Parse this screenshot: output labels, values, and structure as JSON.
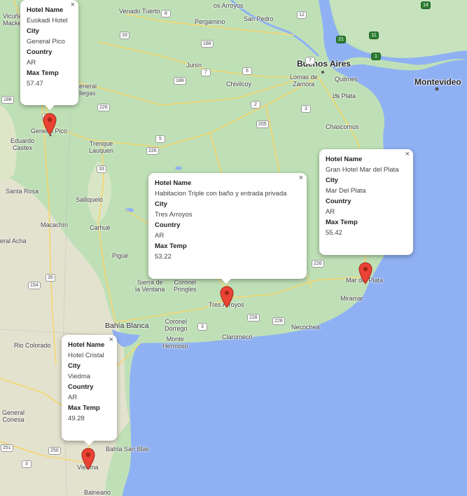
{
  "places": [
    {
      "id": "vicuna-mackenna",
      "text": "Vicuña\nMacke..."
    },
    {
      "id": "venado-tuerto",
      "text": "Venado Tuerto"
    },
    {
      "id": "los-arroyos",
      "text": "os Arroyos"
    },
    {
      "id": "pergamino",
      "text": "Pergamino"
    },
    {
      "id": "san-pedro",
      "text": "San Pedro"
    },
    {
      "id": "buenos-aires",
      "text": "Buenos Aires"
    },
    {
      "id": "montevideo",
      "text": "Montevideo"
    },
    {
      "id": "lomas-de-zamora",
      "text": "Lomas de\nZamora"
    },
    {
      "id": "quilmes",
      "text": "Quilmes"
    },
    {
      "id": "la-plata",
      "text": "La Plata"
    },
    {
      "id": "junin",
      "text": "Junín"
    },
    {
      "id": "chivilcoy",
      "text": "Chivilcoy"
    },
    {
      "id": "general-villegas",
      "text": "eneral\nllegas"
    },
    {
      "id": "general-pico",
      "text": "General Pico"
    },
    {
      "id": "eduardo-castex",
      "text": "Eduardo\nCastex"
    },
    {
      "id": "trenque-lauquen",
      "text": "Trenque\nLauquen"
    },
    {
      "id": "chascomus",
      "text": "Chascomús"
    },
    {
      "id": "santa-rosa",
      "text": "Santa Rosa"
    },
    {
      "id": "salliquelo",
      "text": "Salliqueló"
    },
    {
      "id": "macachin",
      "text": "Macachín"
    },
    {
      "id": "carhue",
      "text": "Carhué"
    },
    {
      "id": "general-acha",
      "text": "eral Acha"
    },
    {
      "id": "pigue",
      "text": "Pigüé"
    },
    {
      "id": "sierra-de-la-ventana",
      "text": "Sierra de\nla Ventana"
    },
    {
      "id": "coronel-pringles",
      "text": "Coronel\nPringles"
    },
    {
      "id": "tres-arroyos",
      "text": "Tres Arroyos"
    },
    {
      "id": "mar-del-plata",
      "text": "Mar del Plata"
    },
    {
      "id": "miramar",
      "text": "Miramar"
    },
    {
      "id": "necochea",
      "text": "Necochea"
    },
    {
      "id": "bahia-blanca",
      "text": "Bahía Blanca"
    },
    {
      "id": "coronel-dorrego",
      "text": "Coronel\nDorrego"
    },
    {
      "id": "monte-hermoso",
      "text": "Monte\nHermoso"
    },
    {
      "id": "claromeco",
      "text": "Claromecó"
    },
    {
      "id": "rio-colorado",
      "text": "Rio Colorado"
    },
    {
      "id": "general-conesa",
      "text": "General\nConesa"
    },
    {
      "id": "bahia-san-blas",
      "text": "Bahía San Blas"
    },
    {
      "id": "viedma",
      "text": "Viedma"
    },
    {
      "id": "balneario",
      "text": "Balneario"
    }
  ],
  "route_shields": [
    {
      "id": "r8",
      "text": "8"
    },
    {
      "id": "r12",
      "text": "12"
    },
    {
      "id": "r33a",
      "text": "33"
    },
    {
      "id": "r188a",
      "text": "188"
    },
    {
      "id": "r188b",
      "text": "188"
    },
    {
      "id": "r188c",
      "text": "188"
    },
    {
      "id": "r7a",
      "text": "7"
    },
    {
      "id": "r7b",
      "text": "7"
    },
    {
      "id": "r5a",
      "text": "5"
    },
    {
      "id": "r5b",
      "text": "5"
    },
    {
      "id": "r205",
      "text": "205"
    },
    {
      "id": "r3a",
      "text": "3"
    },
    {
      "id": "r2",
      "text": "2"
    },
    {
      "id": "r226a",
      "text": "226"
    },
    {
      "id": "r226b",
      "text": "226"
    },
    {
      "id": "r226c",
      "text": "226"
    },
    {
      "id": "r35a",
      "text": "35"
    },
    {
      "id": "r35b",
      "text": "35"
    },
    {
      "id": "r33b",
      "text": "33"
    },
    {
      "id": "r154",
      "text": "154"
    },
    {
      "id": "r228a",
      "text": "228"
    },
    {
      "id": "r228b",
      "text": "228"
    },
    {
      "id": "r3b",
      "text": "3"
    },
    {
      "id": "r250",
      "text": "250"
    },
    {
      "id": "r251",
      "text": "251"
    },
    {
      "id": "r3c",
      "text": "3"
    },
    {
      "id": "r21",
      "text": "21"
    },
    {
      "id": "r11",
      "text": "11"
    },
    {
      "id": "r1",
      "text": "1"
    },
    {
      "id": "r14",
      "text": "14"
    }
  ],
  "popups": [
    {
      "id": "general-pico",
      "close": "×",
      "labels": {
        "hotel": "Hotel Name",
        "city": "City",
        "country": "Country",
        "temp": "Max Temp"
      },
      "hotel": "Euskadi Hotel",
      "city": "General Pico",
      "country": "AR",
      "max_temp": "57.47"
    },
    {
      "id": "tres-arroyos",
      "close": "×",
      "labels": {
        "hotel": "Hotel Name",
        "city": "City",
        "country": "Country",
        "temp": "Max Temp"
      },
      "hotel": "Habitacion Triple con baño y entrada privada",
      "city": "Tres Arroyos",
      "country": "AR",
      "max_temp": "53.22"
    },
    {
      "id": "mar-del-plata",
      "close": "×",
      "labels": {
        "hotel": "Hotel Name",
        "city": "City",
        "country": "Country",
        "temp": "Max Temp"
      },
      "hotel": "Gran Hotel Mar del Plata",
      "city": "Mar Del Plata",
      "country": "AR",
      "max_temp": "55.42"
    },
    {
      "id": "viedma",
      "close": "×",
      "labels": {
        "hotel": "Hotel Name",
        "city": "City",
        "country": "Country",
        "temp": "Max Temp"
      },
      "hotel": "Hotel Cristal",
      "city": "Viedma",
      "country": "AR",
      "max_temp": "49.28"
    }
  ],
  "colors": {
    "land": "#bfe0b6",
    "land_dry": "#e6e2d0",
    "water": "#8fb1f4",
    "marker": "#ea4335",
    "marker_dark": "#a52714",
    "road": "#f8d773"
  }
}
